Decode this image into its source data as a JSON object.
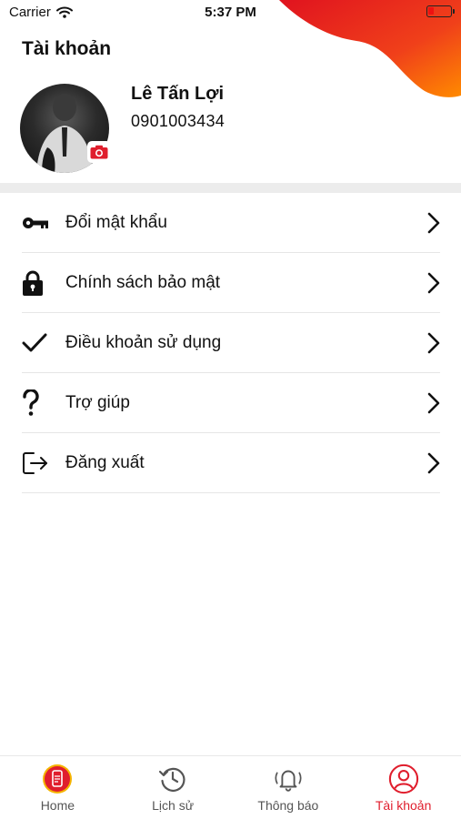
{
  "status_bar": {
    "carrier": "Carrier",
    "time": "5:37 PM"
  },
  "header": {
    "title": "Tài khoản"
  },
  "profile": {
    "name": "Lê Tấn Lợi",
    "phone": "0901003434"
  },
  "menu": {
    "items": [
      {
        "label": "Đổi mật khẩu",
        "icon": "key-icon"
      },
      {
        "label": "Chính sách bảo mật",
        "icon": "lock-icon"
      },
      {
        "label": "Điều khoản sử dụng",
        "icon": "checkmark-icon"
      },
      {
        "label": "Trợ giúp",
        "icon": "question-icon"
      },
      {
        "label": "Đăng xuất",
        "icon": "logout-icon"
      }
    ]
  },
  "tabbar": {
    "tabs": [
      {
        "label": "Home",
        "icon": "home-phone-icon",
        "active": false
      },
      {
        "label": "Lịch sử",
        "icon": "history-icon",
        "active": false
      },
      {
        "label": "Thông báo",
        "icon": "bell-icon",
        "active": false
      },
      {
        "label": "Tài khoản",
        "icon": "account-icon",
        "active": true
      }
    ]
  },
  "colors": {
    "accent": "#e01e2d",
    "blob_start": "#e0131f",
    "blob_end": "#ff8a00"
  }
}
